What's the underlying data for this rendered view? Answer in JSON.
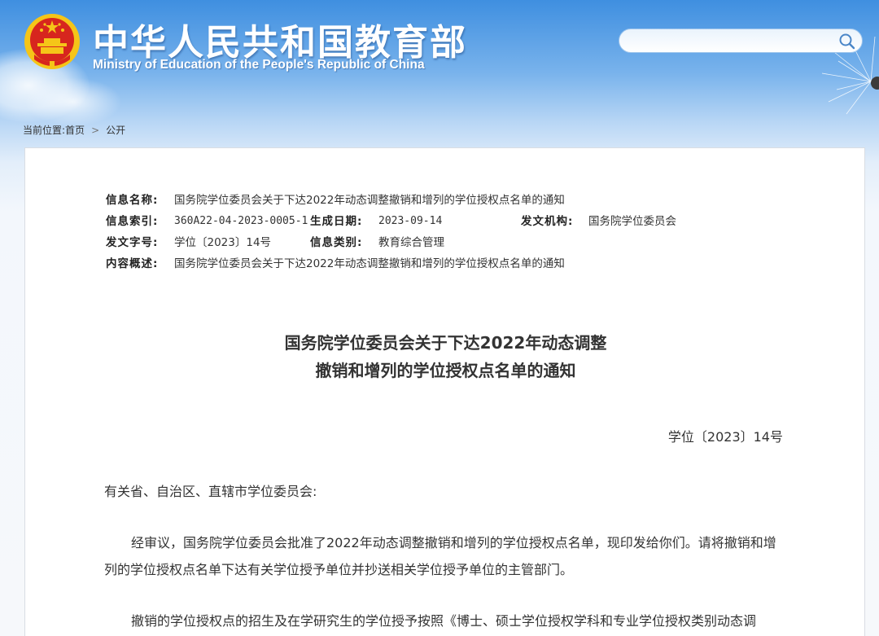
{
  "header": {
    "site_title": "中华人民共和国教育部",
    "site_subtitle": "Ministry of Education of the People's Republic of China",
    "search": {
      "value": "",
      "placeholder": ""
    }
  },
  "breadcrumb": {
    "label": "当前位置:",
    "home": "首页",
    "separator": ">",
    "current": "公开"
  },
  "meta": {
    "name_label": "信息名称:",
    "name_value": "国务院学位委员会关于下达2022年动态调整撤销和增列的学位授权点名单的通知",
    "index_label": "信息索引:",
    "index_value": "360A22-04-2023-0005-1",
    "date_label": "生成日期:",
    "date_value": "2023-09-14",
    "org_label": "发文机构:",
    "org_value": "国务院学位委员会",
    "docno_label": "发文字号:",
    "docno_value": "学位〔2023〕14号",
    "category_label": "信息类别:",
    "category_value": "教育综合管理",
    "summary_label": "内容概述:",
    "summary_value": "国务院学位委员会关于下达2022年动态调整撤销和增列的学位授权点名单的通知"
  },
  "document": {
    "title_line1": "国务院学位委员会关于下达2022年动态调整",
    "title_line2": "撤销和增列的学位授权点名单的通知",
    "number": "学位〔2023〕14号",
    "salutation": "有关省、自治区、直辖市学位委员会:",
    "para1": "经审议，国务院学位委员会批准了2022年动态调整撤销和增列的学位授权点名单，现印发给你们。请将撤销和增列的学位授权点名单下达有关学位授予单位并抄送相关学位授予单位的主管部门。",
    "para2": "撤销的学位授权点的招生及在学研究生的学位授予按照《博士、硕士学位授权学科和专业学位授权类别动态调"
  },
  "colors": {
    "header_blue": "#3f8fe0",
    "text": "#333333",
    "emblem_red": "#d7261e",
    "emblem_gold": "#f5c518"
  }
}
